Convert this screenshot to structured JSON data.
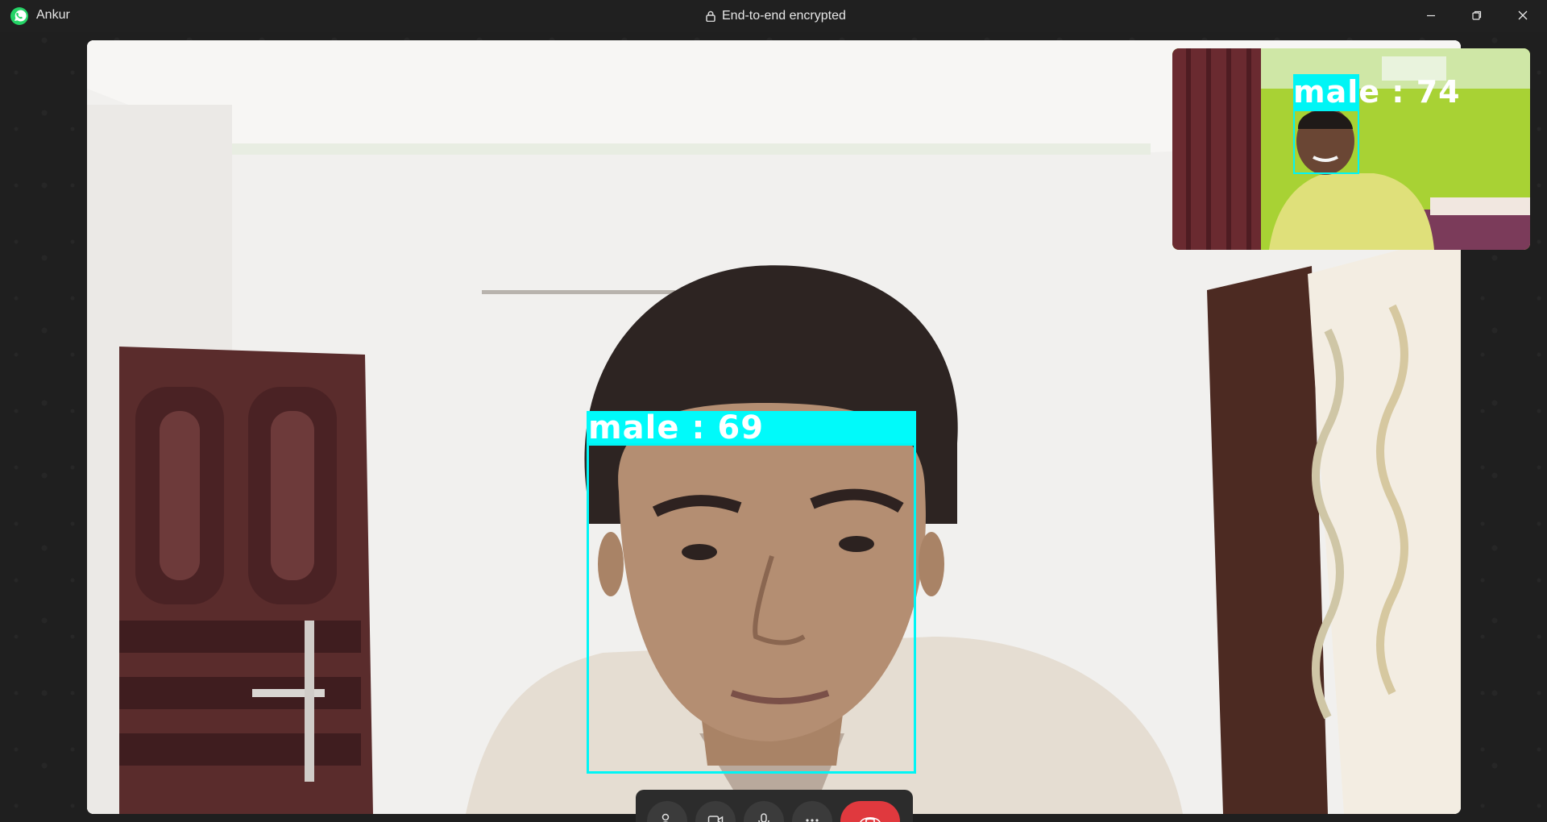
{
  "window": {
    "contact_name": "Ankur",
    "encryption_text": "End-to-end encrypted",
    "app_icon": "whatsapp-icon",
    "controls": [
      "minimize-icon",
      "restore-icon",
      "close-icon"
    ]
  },
  "main_video": {
    "detection_label": "male : 69",
    "box_color": "#00f5f5"
  },
  "self_view": {
    "detection_label": "male : 74",
    "box_color": "#00f5f5"
  },
  "call_controls": {
    "buttons": [
      "people-icon",
      "video-icon",
      "microphone-icon",
      "more-icon",
      "end-call-icon"
    ],
    "end_call_color": "#e0393e"
  },
  "colors": {
    "titlebar": "#202020",
    "background": "#1f1f1f",
    "detection": "#00f5f5"
  }
}
